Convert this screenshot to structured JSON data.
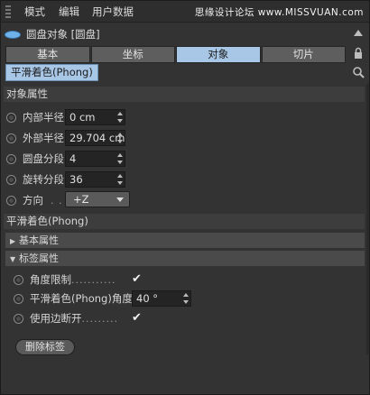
{
  "menubar": {
    "items": [
      "模式",
      "编辑",
      "用户数据"
    ],
    "watermark": "思缘设计论坛 www.MISSVUAN.com"
  },
  "object": {
    "title": "圆盘对象 [圆盘]"
  },
  "tabs": [
    {
      "label": "基本"
    },
    {
      "label": "坐标"
    },
    {
      "label": "对象"
    },
    {
      "label": "切片"
    }
  ],
  "subtab": {
    "label": "平滑着色(Phong)"
  },
  "section_object": {
    "title": "对象属性"
  },
  "params": {
    "inner_radius": {
      "label": "内部半径",
      "value": "0 cm"
    },
    "outer_radius": {
      "label": "外部半径",
      "value": "29.704 cm"
    },
    "disc_segments": {
      "label": "圆盘分段",
      "value": "4"
    },
    "rot_segments": {
      "label": "旋转分段",
      "value": "36"
    },
    "orientation": {
      "label": "方向",
      "dots": ". . .",
      "value": "+Z"
    }
  },
  "section_phong": {
    "title": "平滑着色(Phong)"
  },
  "fold_basic": {
    "label": "基本属性"
  },
  "fold_tag": {
    "label": "标签属性"
  },
  "phong": {
    "angle_limit": {
      "label": "角度限制",
      "dots": "...........",
      "checked": true
    },
    "phong_angle": {
      "label": "平滑着色(Phong)角度",
      "value": "40 °"
    },
    "edge_breaks": {
      "label": "使用边断开",
      "dots": ".........",
      "checked": true
    }
  },
  "delete_tag": {
    "label": "删除标签"
  }
}
